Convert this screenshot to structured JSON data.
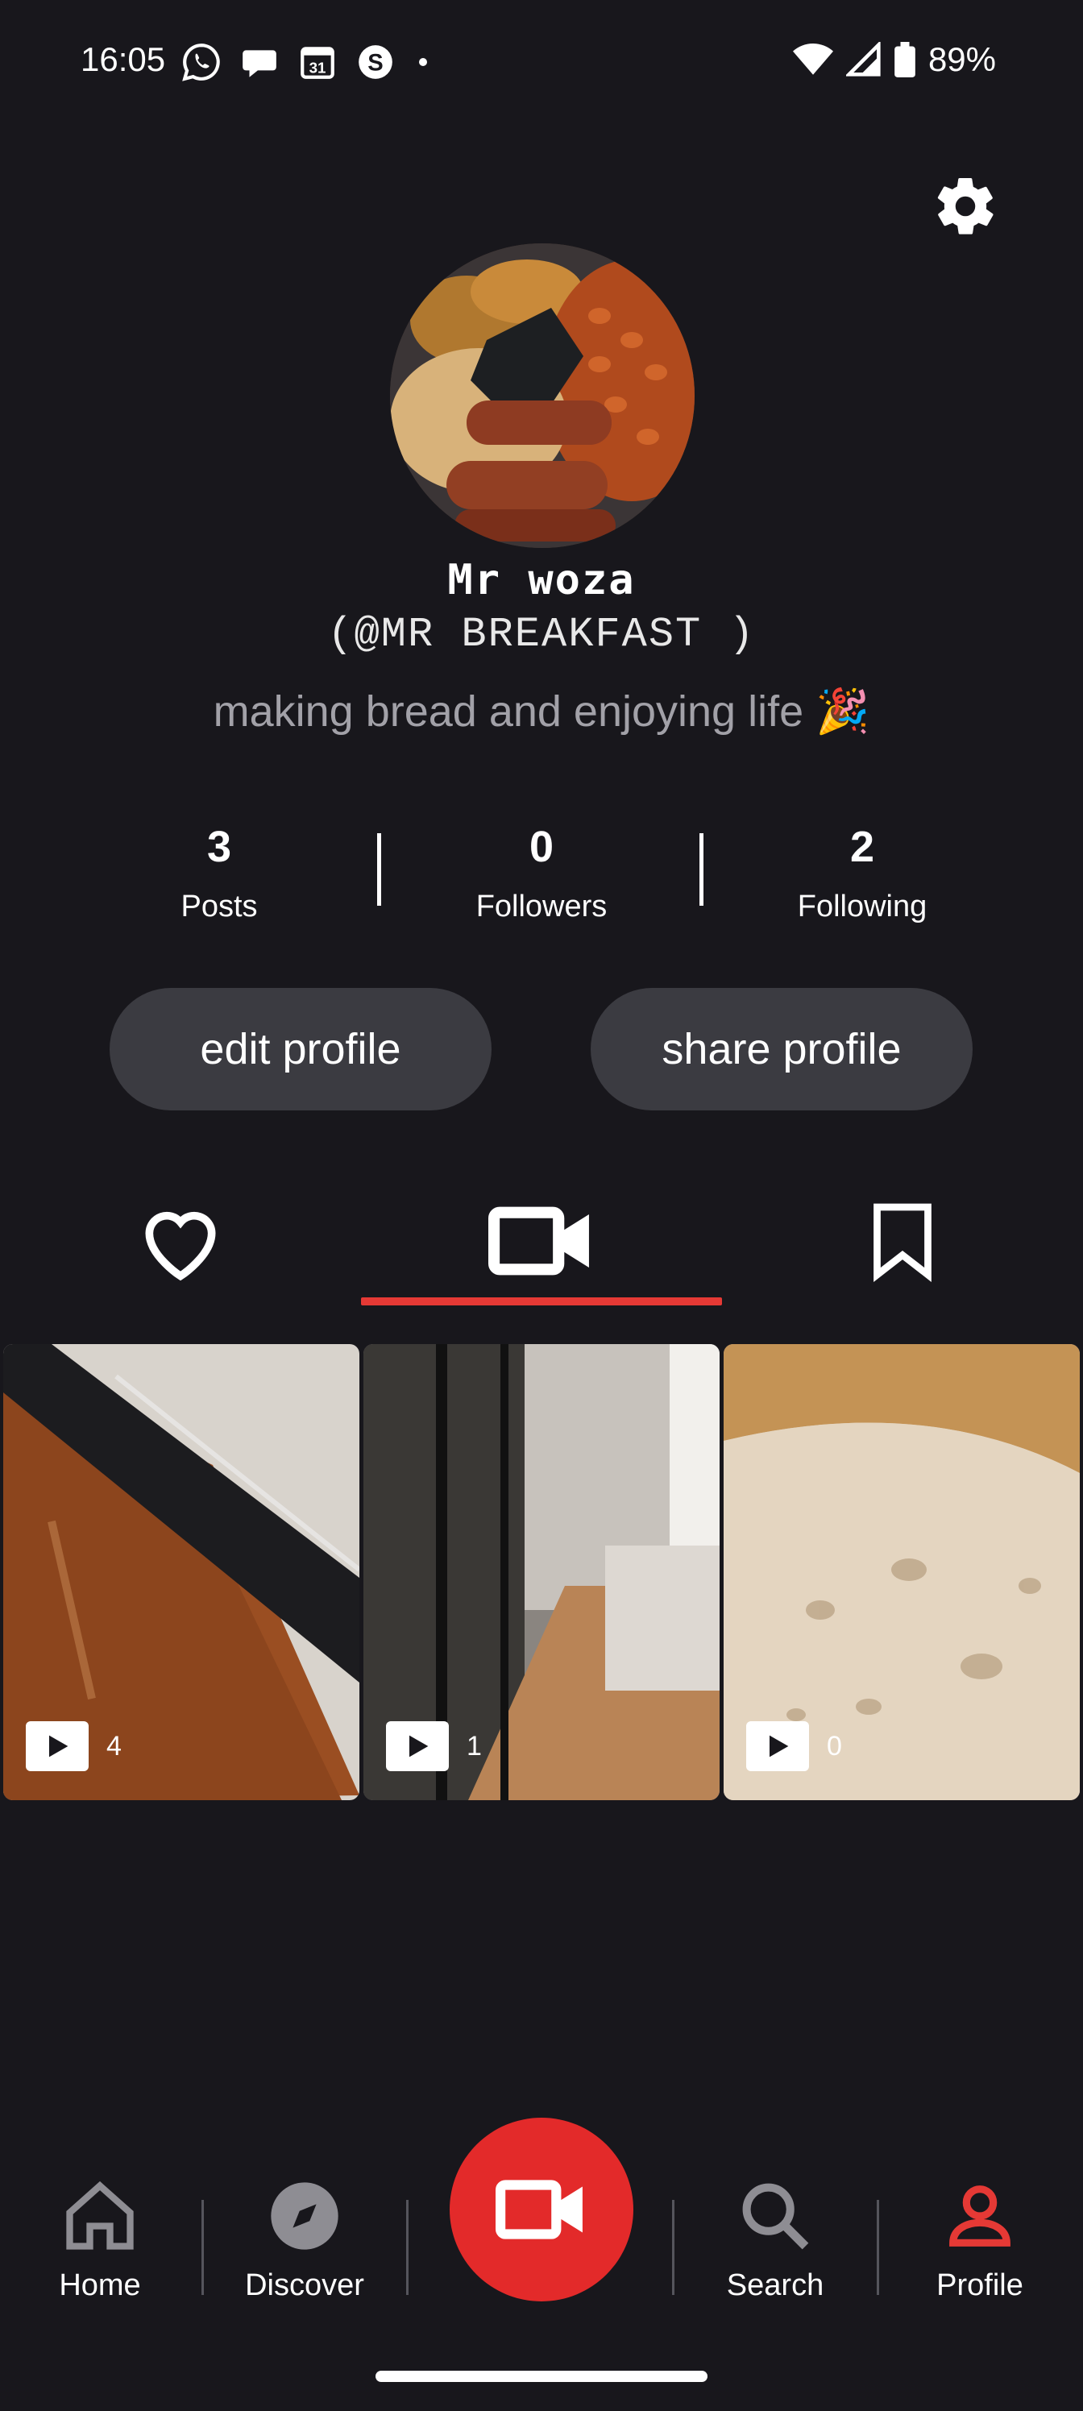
{
  "status_bar": {
    "time": "16:05",
    "battery": "89%",
    "calendar_day": "31",
    "notification_icons": [
      "whatsapp-icon",
      "chat-bubble-icon",
      "calendar-icon",
      "skype-icon",
      "dot-icon"
    ],
    "system_icons": [
      "wifi-icon",
      "signal-icon",
      "battery-icon"
    ]
  },
  "profile": {
    "display_name": "Mr woza",
    "handle": "(@MR BREAKFAST )",
    "bio": "making bread and enjoying life 🎉"
  },
  "stats": [
    {
      "value": "3",
      "label": "Posts"
    },
    {
      "value": "0",
      "label": "Followers"
    },
    {
      "value": "2",
      "label": "Following"
    }
  ],
  "actions": {
    "edit_label": "edit profile",
    "share_label": "share profile"
  },
  "tabs": [
    {
      "icon": "heart-icon",
      "active": false
    },
    {
      "icon": "video-camera-icon",
      "active": true
    },
    {
      "icon": "bookmark-icon",
      "active": false
    }
  ],
  "videos": [
    {
      "count": "4"
    },
    {
      "count": "1"
    },
    {
      "count": "0"
    }
  ],
  "bottom_nav": [
    {
      "label": "Home",
      "icon": "home-icon"
    },
    {
      "label": "Discover",
      "icon": "compass-icon"
    },
    {
      "label": "",
      "icon": "record-video-icon"
    },
    {
      "label": "Search",
      "icon": "search-icon"
    },
    {
      "label": "Profile",
      "icon": "person-icon",
      "active": true
    }
  ],
  "colors": {
    "background": "#18171c",
    "accent": "#e53935",
    "button_bg": "#3b3b41",
    "muted_text": "#a2a1a8"
  }
}
